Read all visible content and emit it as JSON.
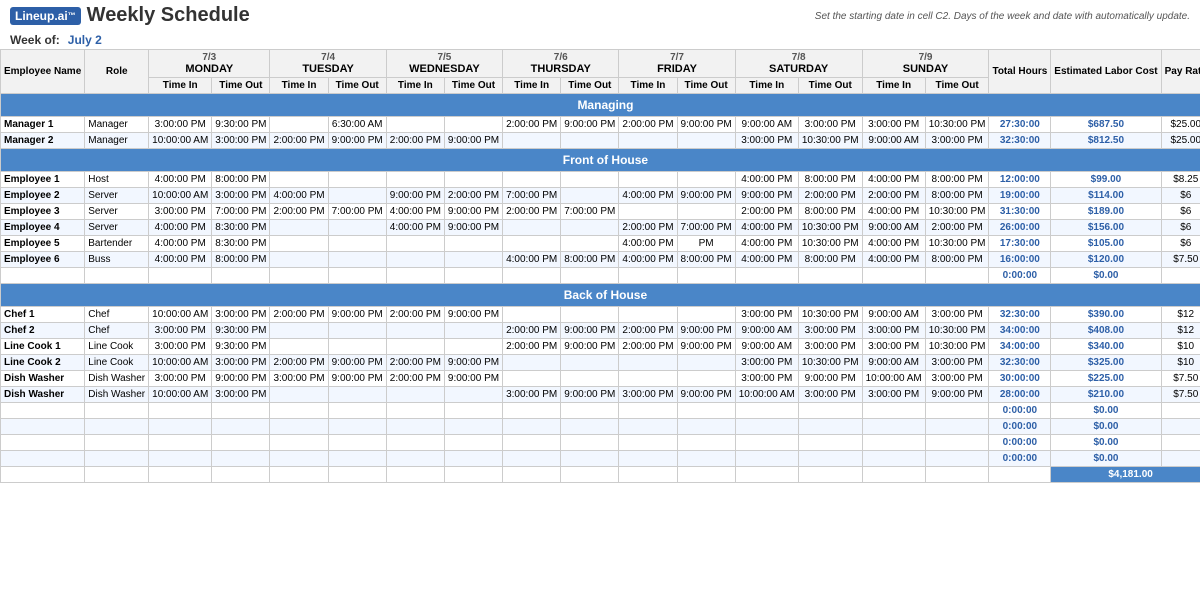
{
  "header": {
    "logo": "Lineup.ai",
    "title": "Weekly Schedule",
    "week_label": "Week of:",
    "week_date": "July 2",
    "hint": "Set the starting date in cell C2. Days of the week and date with automatically update."
  },
  "days": [
    {
      "date": "7/3",
      "day": "MONDAY"
    },
    {
      "date": "7/4",
      "day": "TUESDAY"
    },
    {
      "date": "7/5",
      "day": "WEDNESDAY"
    },
    {
      "date": "7/6",
      "day": "THURSDAY"
    },
    {
      "date": "7/7",
      "day": "FRIDAY"
    },
    {
      "date": "7/8",
      "day": "SATURDAY"
    },
    {
      "date": "7/9",
      "day": "SUNDAY"
    }
  ],
  "col_headers": [
    "Employee Name",
    "Role",
    "Time In",
    "Time Out",
    "Time In",
    "Time Out",
    "Time In",
    "Time Out",
    "Time In",
    "Time Out",
    "Time In",
    "Time Out",
    "Time In",
    "Time Out",
    "Time In",
    "Time Out",
    "Total Hours",
    "Estimated Labor Cost",
    "Pay Rate"
  ],
  "sections": {
    "managing": {
      "label": "Managing",
      "rows": [
        {
          "name": "Manager 1",
          "role": "Manager",
          "mon_in": "3:00:00 PM",
          "mon_out": "9:30:00 PM",
          "tue_in": "",
          "tue_out": "6:30:00 AM",
          "wed_in": "",
          "wed_out": "",
          "thu_in": "2:00:00 PM",
          "thu_out": "9:00:00 PM",
          "fri_in": "2:00:00 PM",
          "fri_out": "9:00:00 PM",
          "sat_in": "9:00:00 AM",
          "sat_out": "3:00:00 PM",
          "sun_in": "3:00:00 PM",
          "sun_out": "10:30:00 PM",
          "total": "27:30:00",
          "cost": "$687.50",
          "rate": "$25.00"
        },
        {
          "name": "Manager 2",
          "role": "Manager",
          "mon_in": "10:00:00 AM",
          "mon_out": "3:00:00 PM",
          "tue_in": "2:00:00 PM",
          "tue_out": "9:00:00 PM",
          "wed_in": "2:00:00 PM",
          "wed_out": "9:00:00 PM",
          "thu_in": "",
          "thu_out": "",
          "fri_in": "",
          "fri_out": "",
          "sat_in": "3:00:00 PM",
          "sat_out": "10:30:00 PM",
          "sun_in": "9:00:00 AM",
          "sun_out": "3:00:00 PM",
          "total": "32:30:00",
          "cost": "$812.50",
          "rate": "$25.00"
        }
      ]
    },
    "front_of_house": {
      "label": "Front of House",
      "rows": [
        {
          "name": "Employee 1",
          "role": "Host",
          "mon_in": "4:00:00 PM",
          "mon_out": "8:00:00 PM",
          "tue_in": "",
          "tue_out": "",
          "wed_in": "",
          "wed_out": "",
          "thu_in": "",
          "thu_out": "",
          "fri_in": "",
          "fri_out": "",
          "sat_in": "4:00:00 PM",
          "sat_out": "8:00:00 PM",
          "sun_in": "4:00:00 PM",
          "sun_out": "8:00:00 PM",
          "total": "12:00:00",
          "cost": "$99.00",
          "rate": "$8.25"
        },
        {
          "name": "Employee 2",
          "role": "Server",
          "mon_in": "10:00:00 AM",
          "mon_out": "3:00:00 PM",
          "tue_in": "4:00:00 PM",
          "tue_out": "",
          "wed_in": "9:00:00 PM",
          "wed_out": "2:00:00 PM",
          "thu_in": "7:00:00 PM",
          "thu_out": "",
          "fri_in": "4:00:00 PM",
          "fri_out": "9:00:00 PM",
          "sat_in": "9:00:00 PM",
          "sat_out": "2:00:00 PM",
          "sun_in": "2:00:00 PM",
          "sun_out": "8:00:00 PM",
          "total": "19:00:00",
          "cost": "$114.00",
          "rate": "$6"
        },
        {
          "name": "Employee 3",
          "role": "Server",
          "mon_in": "3:00:00 PM",
          "mon_out": "7:00:00 PM",
          "tue_in": "2:00:00 PM",
          "tue_out": "7:00:00 PM",
          "wed_in": "4:00:00 PM",
          "wed_out": "9:00:00 PM",
          "thu_in": "2:00:00 PM",
          "thu_out": "7:00:00 PM",
          "fri_in": "",
          "fri_out": "",
          "sat_in": "2:00:00 PM",
          "sat_out": "8:00:00 PM",
          "sun_in": "4:00:00 PM",
          "sun_out": "10:30:00 PM",
          "total": "31:30:00",
          "cost": "$189.00",
          "rate": "$6"
        },
        {
          "name": "Employee 4",
          "role": "Server",
          "mon_in": "4:00:00 PM",
          "mon_out": "8:30:00 PM",
          "tue_in": "",
          "tue_out": "",
          "wed_in": "4:00:00 PM",
          "wed_out": "9:00:00 PM",
          "thu_in": "",
          "thu_out": "",
          "fri_in": "2:00:00 PM",
          "fri_out": "7:00:00 PM",
          "sat_in": "4:00:00 PM",
          "sat_out": "10:30:00 PM",
          "sun_in": "9:00:00 AM",
          "sun_out": "2:00:00 PM",
          "total": "26:00:00",
          "cost": "$156.00",
          "rate": "$6"
        },
        {
          "name": "Employee 5",
          "role": "Bartender",
          "mon_in": "4:00:00 PM",
          "mon_out": "8:30:00 PM",
          "tue_in": "",
          "tue_out": "",
          "wed_in": "",
          "wed_out": "",
          "thu_in": "",
          "thu_out": "",
          "fri_in": "4:00:00 PM",
          "fri_out": "PM",
          "sat_in": "4:00:00 PM",
          "sat_out": "10:30:00 PM",
          "sun_in": "4:00:00 PM",
          "sun_out": "10:30:00 PM",
          "total": "17:30:00",
          "cost": "$105.00",
          "rate": "$6"
        },
        {
          "name": "Employee 6",
          "role": "Buss",
          "mon_in": "4:00:00 PM",
          "mon_out": "8:00:00 PM",
          "tue_in": "",
          "tue_out": "",
          "wed_in": "",
          "wed_out": "",
          "thu_in": "4:00:00 PM",
          "thu_out": "8:00:00 PM",
          "fri_in": "4:00:00 PM",
          "fri_out": "8:00:00 PM",
          "sat_in": "4:00:00 PM",
          "sat_out": "8:00:00 PM",
          "sun_in": "4:00:00 PM",
          "sun_out": "8:00:00 PM",
          "total": "16:00:00",
          "cost": "$120.00",
          "rate": "$7.50"
        },
        {
          "name": "",
          "role": "",
          "mon_in": "",
          "mon_out": "",
          "tue_in": "",
          "tue_out": "",
          "wed_in": "",
          "wed_out": "",
          "thu_in": "",
          "thu_out": "",
          "fri_in": "",
          "fri_out": "",
          "sat_in": "",
          "sat_out": "",
          "sun_in": "",
          "sun_out": "",
          "total": "0:00:00",
          "cost": "$0.00",
          "rate": ""
        }
      ]
    },
    "back_of_house": {
      "label": "Back of House",
      "rows": [
        {
          "name": "Chef 1",
          "role": "Chef",
          "mon_in": "10:00:00 AM",
          "mon_out": "3:00:00 PM",
          "tue_in": "2:00:00 PM",
          "tue_out": "9:00:00 PM",
          "wed_in": "2:00:00 PM",
          "wed_out": "9:00:00 PM",
          "thu_in": "",
          "thu_out": "",
          "fri_in": "",
          "fri_out": "",
          "sat_in": "3:00:00 PM",
          "sat_out": "10:30:00 PM",
          "sun_in": "9:00:00 AM",
          "sun_out": "3:00:00 PM",
          "total": "32:30:00",
          "cost": "$390.00",
          "rate": "$12"
        },
        {
          "name": "Chef 2",
          "role": "Chef",
          "mon_in": "3:00:00 PM",
          "mon_out": "9:30:00 PM",
          "tue_in": "",
          "tue_out": "",
          "wed_in": "",
          "wed_out": "",
          "thu_in": "2:00:00 PM",
          "thu_out": "9:00:00 PM",
          "fri_in": "2:00:00 PM",
          "fri_out": "9:00:00 PM",
          "sat_in": "9:00:00 AM",
          "sat_out": "3:00:00 PM",
          "sun_in": "3:00:00 PM",
          "sun_out": "10:30:00 PM",
          "total": "34:00:00",
          "cost": "$408.00",
          "rate": "$12"
        },
        {
          "name": "Line Cook 1",
          "role": "Line Cook",
          "mon_in": "3:00:00 PM",
          "mon_out": "9:30:00 PM",
          "tue_in": "",
          "tue_out": "",
          "wed_in": "",
          "wed_out": "",
          "thu_in": "2:00:00 PM",
          "thu_out": "9:00:00 PM",
          "fri_in": "2:00:00 PM",
          "fri_out": "9:00:00 PM",
          "sat_in": "9:00:00 AM",
          "sat_out": "3:00:00 PM",
          "sun_in": "3:00:00 PM",
          "sun_out": "10:30:00 PM",
          "total": "34:00:00",
          "cost": "$340.00",
          "rate": "$10"
        },
        {
          "name": "Line Cook 2",
          "role": "Line Cook",
          "mon_in": "10:00:00 AM",
          "mon_out": "3:00:00 PM",
          "tue_in": "2:00:00 PM",
          "tue_out": "9:00:00 PM",
          "wed_in": "2:00:00 PM",
          "wed_out": "9:00:00 PM",
          "thu_in": "",
          "thu_out": "",
          "fri_in": "",
          "fri_out": "",
          "sat_in": "3:00:00 PM",
          "sat_out": "10:30:00 PM",
          "sun_in": "9:00:00 AM",
          "sun_out": "3:00:00 PM",
          "total": "32:30:00",
          "cost": "$325.00",
          "rate": "$10"
        },
        {
          "name": "Dish Washer",
          "role": "Dish Washer",
          "mon_in": "3:00:00 PM",
          "mon_out": "9:00:00 PM",
          "tue_in": "3:00:00 PM",
          "tue_out": "9:00:00 PM",
          "wed_in": "2:00:00 PM",
          "wed_out": "9:00:00 PM",
          "thu_in": "",
          "thu_out": "",
          "fri_in": "",
          "fri_out": "",
          "sat_in": "3:00:00 PM",
          "sat_out": "9:00:00 PM",
          "sun_in": "10:00:00 AM",
          "sun_out": "3:00:00 PM",
          "total": "30:00:00",
          "cost": "$225.00",
          "rate": "$7.50"
        },
        {
          "name": "Dish Washer",
          "role": "Dish Washer",
          "mon_in": "10:00:00 AM",
          "mon_out": "3:00:00 PM",
          "tue_in": "",
          "tue_out": "",
          "wed_in": "",
          "wed_out": "",
          "thu_in": "3:00:00 PM",
          "thu_out": "9:00:00 PM",
          "fri_in": "3:00:00 PM",
          "fri_out": "9:00:00 PM",
          "sat_in": "10:00:00 AM",
          "sat_out": "3:00:00 PM",
          "sun_in": "3:00:00 PM",
          "sun_out": "9:00:00 PM",
          "total": "28:00:00",
          "cost": "$210.00",
          "rate": "$7.50"
        },
        {
          "name": "",
          "role": "",
          "total": "0:00:00",
          "cost": "$0.00",
          "rate": ""
        },
        {
          "name": "",
          "role": "",
          "total": "0:00:00",
          "cost": "$0.00",
          "rate": ""
        },
        {
          "name": "",
          "role": "",
          "total": "0:00:00",
          "cost": "$0.00",
          "rate": ""
        },
        {
          "name": "",
          "role": "",
          "total": "0:00:00",
          "cost": "$0.00",
          "rate": ""
        }
      ]
    }
  },
  "grand_total_label": "$4,181.00"
}
